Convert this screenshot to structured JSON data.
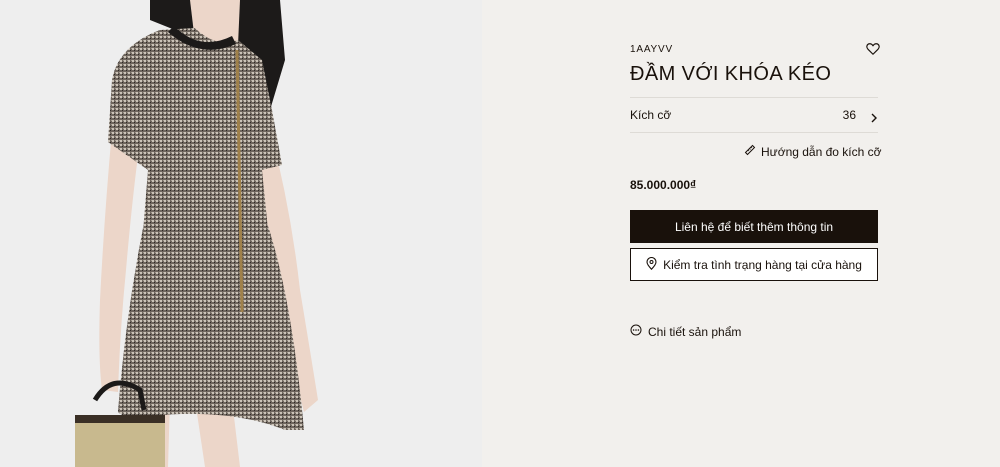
{
  "product": {
    "sku": "1AAYVV",
    "title": "ĐẦM VỚI KHÓA KÉO",
    "size_label": "Kích cỡ",
    "size_value": "36",
    "size_guide": "Hướng dẫn đo kích cỡ",
    "price": "85.000.000₫",
    "contact_button": "Liên hệ để biết thêm thông tin",
    "stock_button": "Kiểm tra tình trạng hàng tại cửa hàng",
    "details_link": "Chi tiết sản phẩm"
  },
  "icons": {
    "wishlist": "heart-outline-icon",
    "size_chevron": "chevron-right-icon",
    "ruler": "ruler-icon",
    "location": "location-pin-icon",
    "details": "more-circle-icon"
  },
  "colors": {
    "primary": "#19110b",
    "panel_background": "#f2f0ed",
    "image_background": "#eeeeee"
  }
}
